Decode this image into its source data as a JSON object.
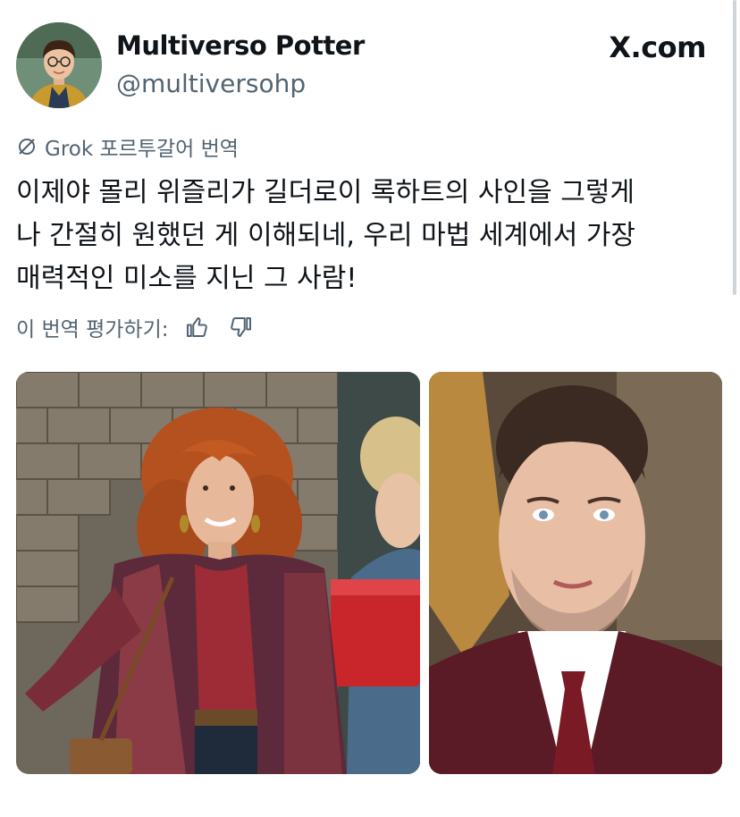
{
  "author": {
    "name": "Multiverso Potter",
    "handle": "@multiversohp"
  },
  "brand": {
    "label": "X.com"
  },
  "translation": {
    "icon": "grok-icon",
    "label": "Grok 포르투갈어 번역"
  },
  "post": {
    "text": "이제야 몰리 위즐리가 길더로이 록하트의 사인을 그렇게\n나 간절히 원했던 게 이해되네, 우리 마법 세계에서 가장\n매력적인 미소를 지닌 그 사람!"
  },
  "rating": {
    "label": "이 번역 평가하기:",
    "like_icon": "thumbs-up-icon",
    "dislike_icon": "thumbs-down-icon"
  },
  "media": {
    "left_photo": "photo-woman-red-hair",
    "right_photo": "photo-man-suit"
  },
  "colors": {
    "text": "#0f1419",
    "secondary": "#536471"
  }
}
